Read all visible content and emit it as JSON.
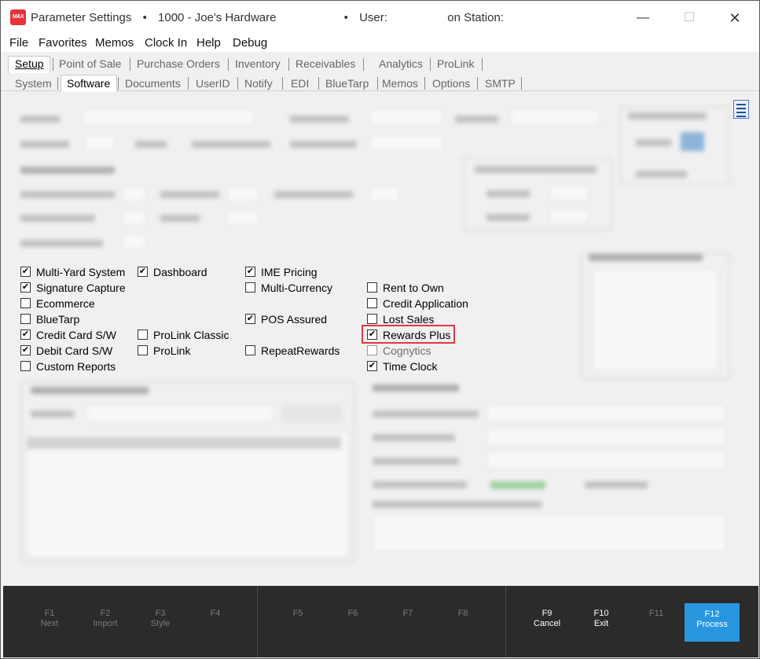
{
  "titlebar": {
    "logo": "MAX",
    "app_title": "Parameter Settings",
    "store": "1000 - Joe's Hardware",
    "user_label": "User:",
    "station_label": "on Station:",
    "separator": "•"
  },
  "menu": [
    "File",
    "Favorites",
    "Memos",
    "Clock In",
    "Help",
    "Debug"
  ],
  "main_tabs": [
    "Setup",
    "Point of Sale",
    "Purchase Orders",
    "Inventory",
    "Receivables",
    "Analytics",
    "ProLink"
  ],
  "sub_tabs": [
    "System",
    "Software",
    "Documents",
    "UserID",
    "Notify",
    "EDI",
    "BlueTarp",
    "Memos",
    "Options",
    "SMTP"
  ],
  "software_options": {
    "multi_yard_system": {
      "label": "Multi-Yard System",
      "checked": true
    },
    "signature_capture": {
      "label": "Signature Capture",
      "checked": true
    },
    "ecommerce": {
      "label": "Ecommerce",
      "checked": false
    },
    "bluetarp": {
      "label": "BlueTarp",
      "checked": false
    },
    "credit_card_sw": {
      "label": "Credit Card S/W",
      "checked": true
    },
    "debit_card_sw": {
      "label": "Debit Card S/W",
      "checked": true
    },
    "custom_reports": {
      "label": "Custom Reports",
      "checked": false
    },
    "dashboard": {
      "label": "Dashboard",
      "checked": true
    },
    "prolink_classic": {
      "label": "ProLink Classic",
      "checked": false
    },
    "prolink": {
      "label": "ProLink",
      "checked": false
    },
    "ime_pricing": {
      "label": "IME Pricing",
      "checked": true
    },
    "multi_currency": {
      "label": "Multi-Currency",
      "checked": false
    },
    "pos_assured": {
      "label": "POS Assured",
      "checked": true
    },
    "repeat_rewards": {
      "label": "RepeatRewards",
      "checked": false
    },
    "rent_to_own": {
      "label": "Rent to Own",
      "checked": false
    },
    "credit_application": {
      "label": "Credit Application",
      "checked": false
    },
    "lost_sales": {
      "label": "Lost Sales",
      "checked": false
    },
    "rewards_plus": {
      "label": "Rewards Plus",
      "checked": true
    },
    "cognytics": {
      "label": "Cognytics",
      "checked": false
    },
    "time_clock": {
      "label": "Time Clock",
      "checked": true
    }
  },
  "check_glyph": "✔",
  "fkeys": [
    {
      "key": "F1",
      "label": "Next"
    },
    {
      "key": "F2",
      "label": "Import"
    },
    {
      "key": "F3",
      "label": "Style"
    },
    {
      "key": "F4",
      "label": ""
    },
    {
      "key": "F5",
      "label": ""
    },
    {
      "key": "F6",
      "label": ""
    },
    {
      "key": "F7",
      "label": ""
    },
    {
      "key": "F8",
      "label": ""
    },
    {
      "key": "F9",
      "label": "Cancel"
    },
    {
      "key": "F10",
      "label": "Exit"
    },
    {
      "key": "F11",
      "label": ""
    },
    {
      "key": "F12",
      "label": "Process"
    }
  ],
  "colors": {
    "accent_blue": "#2896df",
    "highlight_red": "#e0383f",
    "footer_bg": "#2b2b2b"
  }
}
